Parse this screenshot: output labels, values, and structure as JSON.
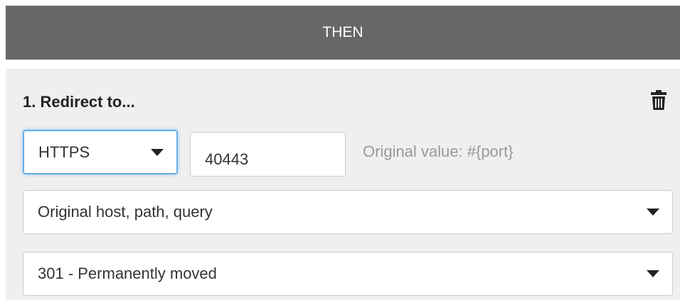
{
  "header": {
    "title": "THEN"
  },
  "action": {
    "title": "1. Redirect to...",
    "delete_icon": "trash-icon",
    "protocol": {
      "selected": "HTTPS"
    },
    "port": {
      "value": "40443",
      "hint": "Original value: #{port}"
    },
    "target": {
      "selected": "Original host, path, query"
    },
    "status_code": {
      "selected": "301 - Permanently moved"
    }
  },
  "colors": {
    "header_bg": "#676767",
    "panel_bg": "#efefef",
    "focus_border": "#66afe9",
    "hint_text": "#999999"
  }
}
